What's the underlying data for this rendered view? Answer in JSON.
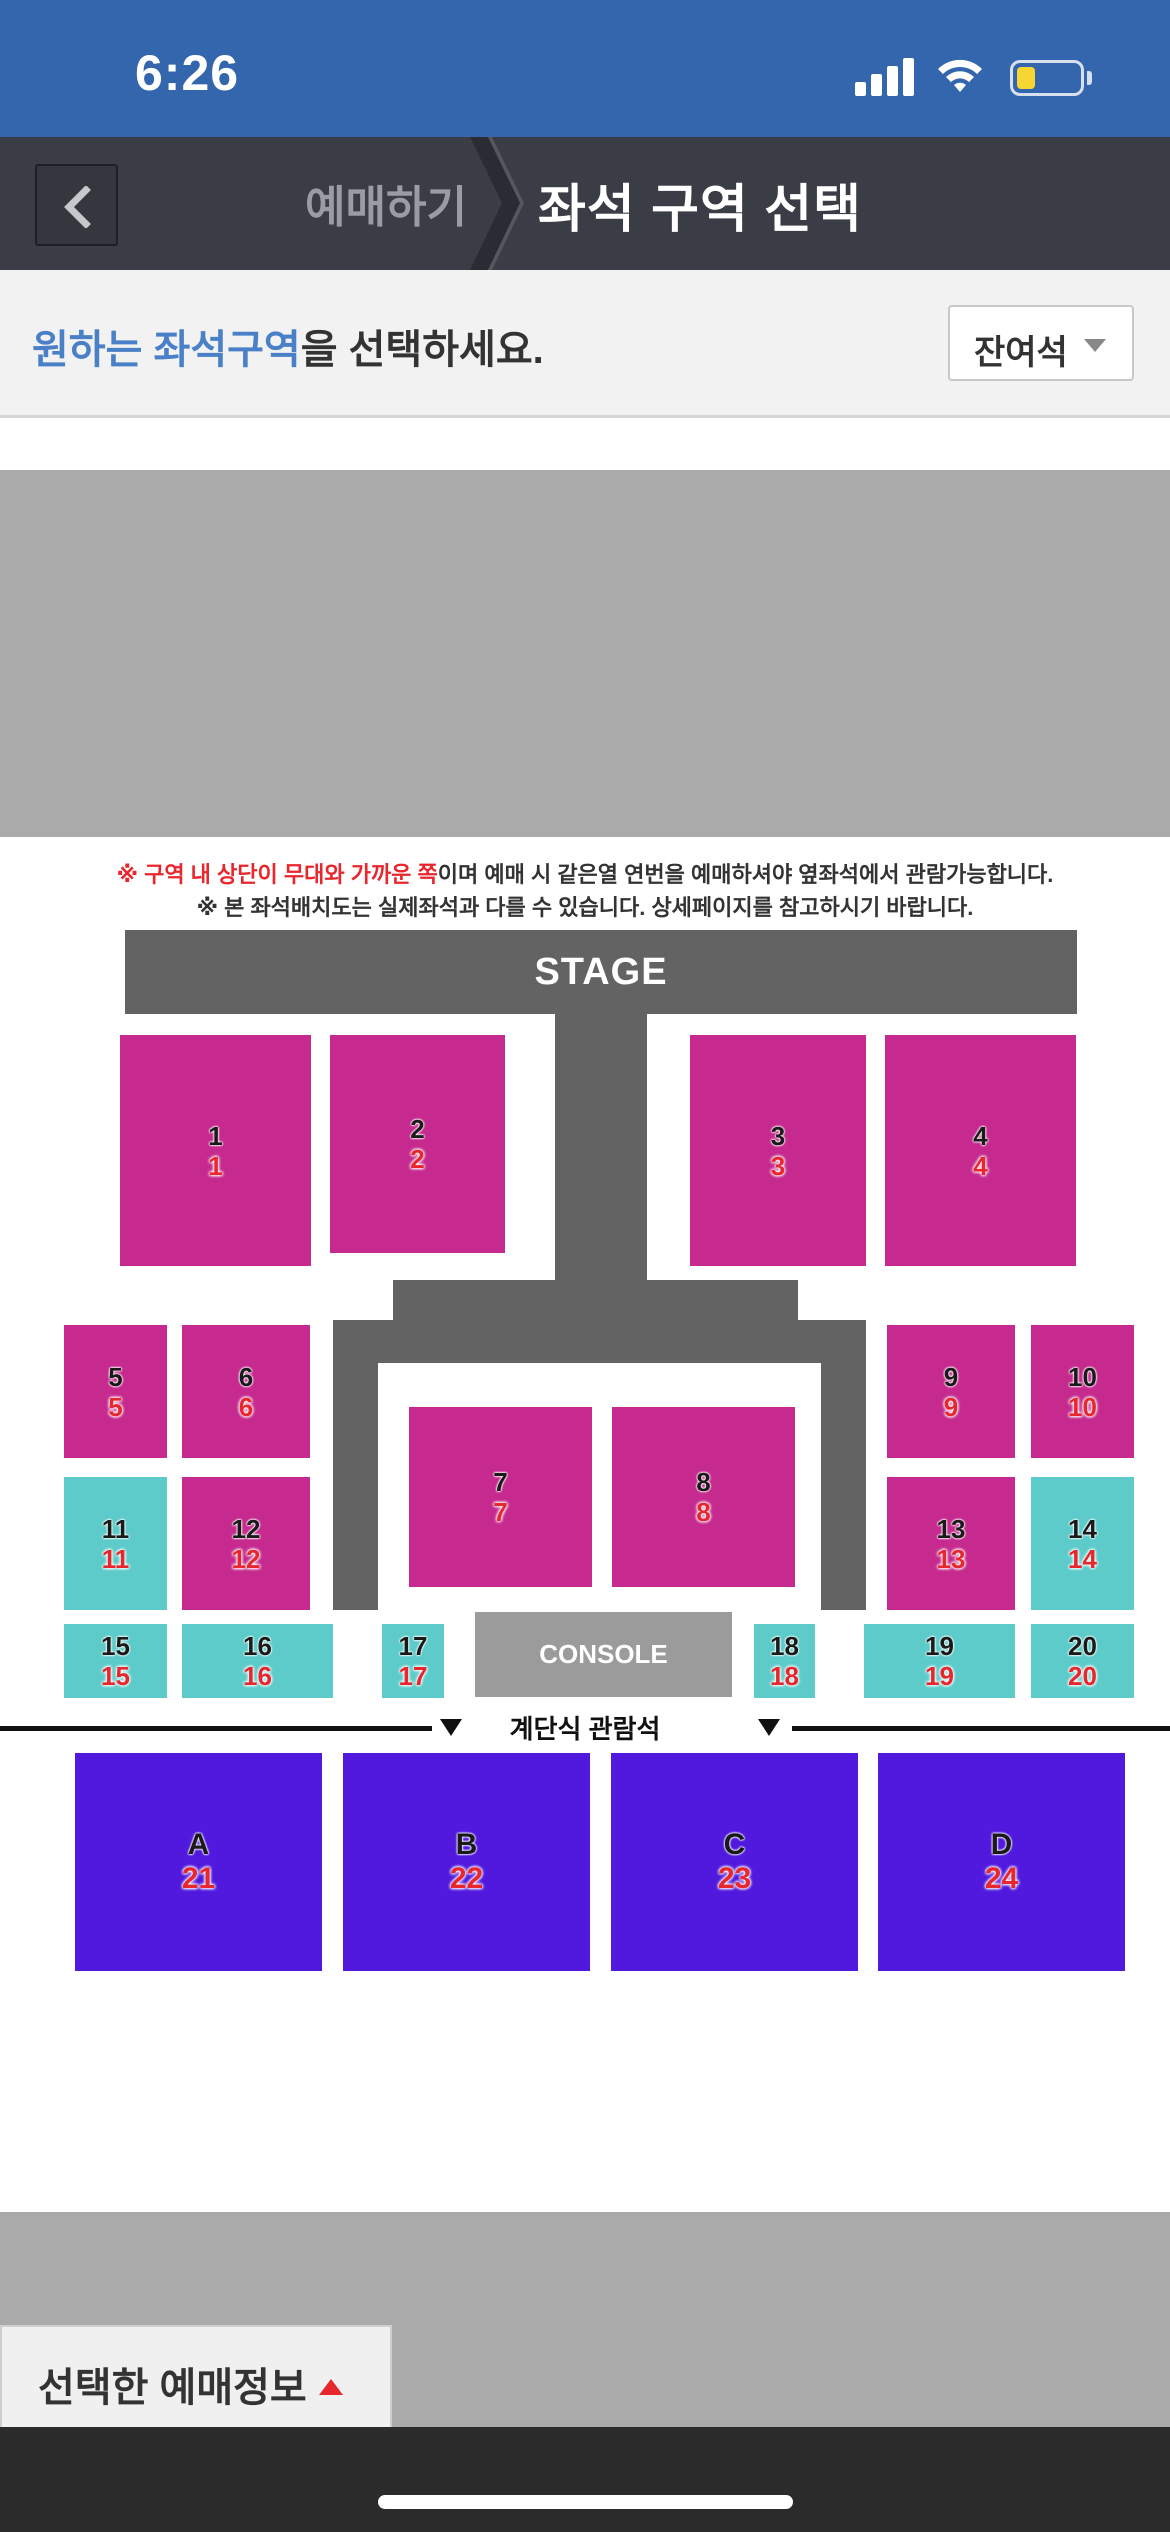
{
  "status_bar": {
    "time": "6:26"
  },
  "nav": {
    "prev_label": "예매하기",
    "current_title": "좌석 구역 선택"
  },
  "instruction": {
    "highlight": "원하는 좌석구역",
    "rest": "을 선택하세요."
  },
  "filter": {
    "label": "잔여석"
  },
  "seat_map": {
    "notice_red": "※ 구역 내 상단이 무대와 가까운 쪽",
    "notice_rest": "이며 예매 시 같은열 연번을 예매하셔야 옆좌석에서 관람가능합니다.",
    "notice2": "※ 본 좌석배치도는 실제좌석과 다를 수 있습니다. 상세페이지를 참고하시기 바랍니다.",
    "stage": "STAGE",
    "console": "CONSOLE",
    "bleacher_label": "계단식 관람석",
    "colors": {
      "magenta": "#c62a8e",
      "teal": "#5ccbc9",
      "purple": "#5119de",
      "stage": "#636363"
    },
    "sections": [
      {
        "label": "1",
        "count": "1"
      },
      {
        "label": "2",
        "count": "2"
      },
      {
        "label": "3",
        "count": "3"
      },
      {
        "label": "4",
        "count": "4"
      },
      {
        "label": "5",
        "count": "5"
      },
      {
        "label": "6",
        "count": "6"
      },
      {
        "label": "7",
        "count": "7"
      },
      {
        "label": "8",
        "count": "8"
      },
      {
        "label": "9",
        "count": "9"
      },
      {
        "label": "10",
        "count": "10"
      },
      {
        "label": "11",
        "count": "11"
      },
      {
        "label": "12",
        "count": "12"
      },
      {
        "label": "13",
        "count": "13"
      },
      {
        "label": "14",
        "count": "14"
      },
      {
        "label": "15",
        "count": "15"
      },
      {
        "label": "16",
        "count": "16"
      },
      {
        "label": "17",
        "count": "17"
      },
      {
        "label": "18",
        "count": "18"
      },
      {
        "label": "19",
        "count": "19"
      },
      {
        "label": "20",
        "count": "20"
      },
      {
        "label": "A",
        "count": "21"
      },
      {
        "label": "B",
        "count": "22"
      },
      {
        "label": "C",
        "count": "23"
      },
      {
        "label": "D",
        "count": "24"
      }
    ]
  },
  "bottom": {
    "selected_info_label": "선택한 예매정보"
  }
}
